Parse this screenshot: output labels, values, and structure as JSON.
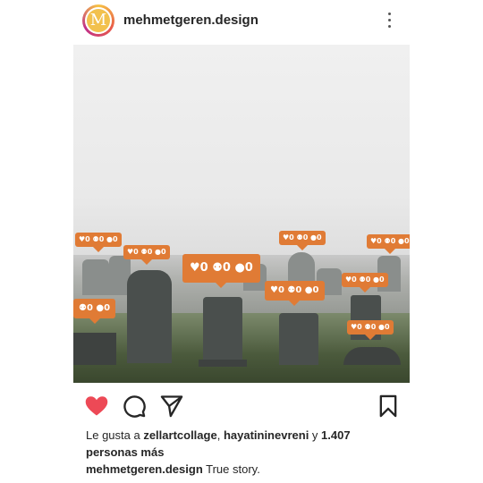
{
  "header": {
    "avatar_letter": "M",
    "username": "mehmetgeren.design"
  },
  "bubbles": [
    {
      "text": "♥0 ⚉0 ●0",
      "size": "s"
    },
    {
      "text": "♥0 ⚉0 ●0",
      "size": "s"
    },
    {
      "text": "♥0 ⚉0 ●0",
      "size": "l"
    },
    {
      "text": "♥0 ⚉0 ●0",
      "size": "s"
    },
    {
      "text": "♥0 ⚉0 ●0",
      "size": "s"
    },
    {
      "text": "⚉0 ●0",
      "size": "m"
    },
    {
      "text": "♥0 ⚉0 ●0",
      "size": "m"
    },
    {
      "text": "♥0 ⚉0 ●0",
      "size": "s"
    },
    {
      "text": "♥0 ⚉0 ●0",
      "size": "s"
    }
  ],
  "likes": {
    "prefix": "Le gusta a ",
    "user1": "zellartcollage",
    "sep": ", ",
    "user2": "hayatininevreni",
    "and": " y ",
    "count": "1.407",
    "suffix": "personas más"
  },
  "caption": {
    "username": "mehmetgeren.design",
    "text": " True story."
  },
  "colors": {
    "heart": "#ed4956",
    "bubble": "#e07b35"
  }
}
